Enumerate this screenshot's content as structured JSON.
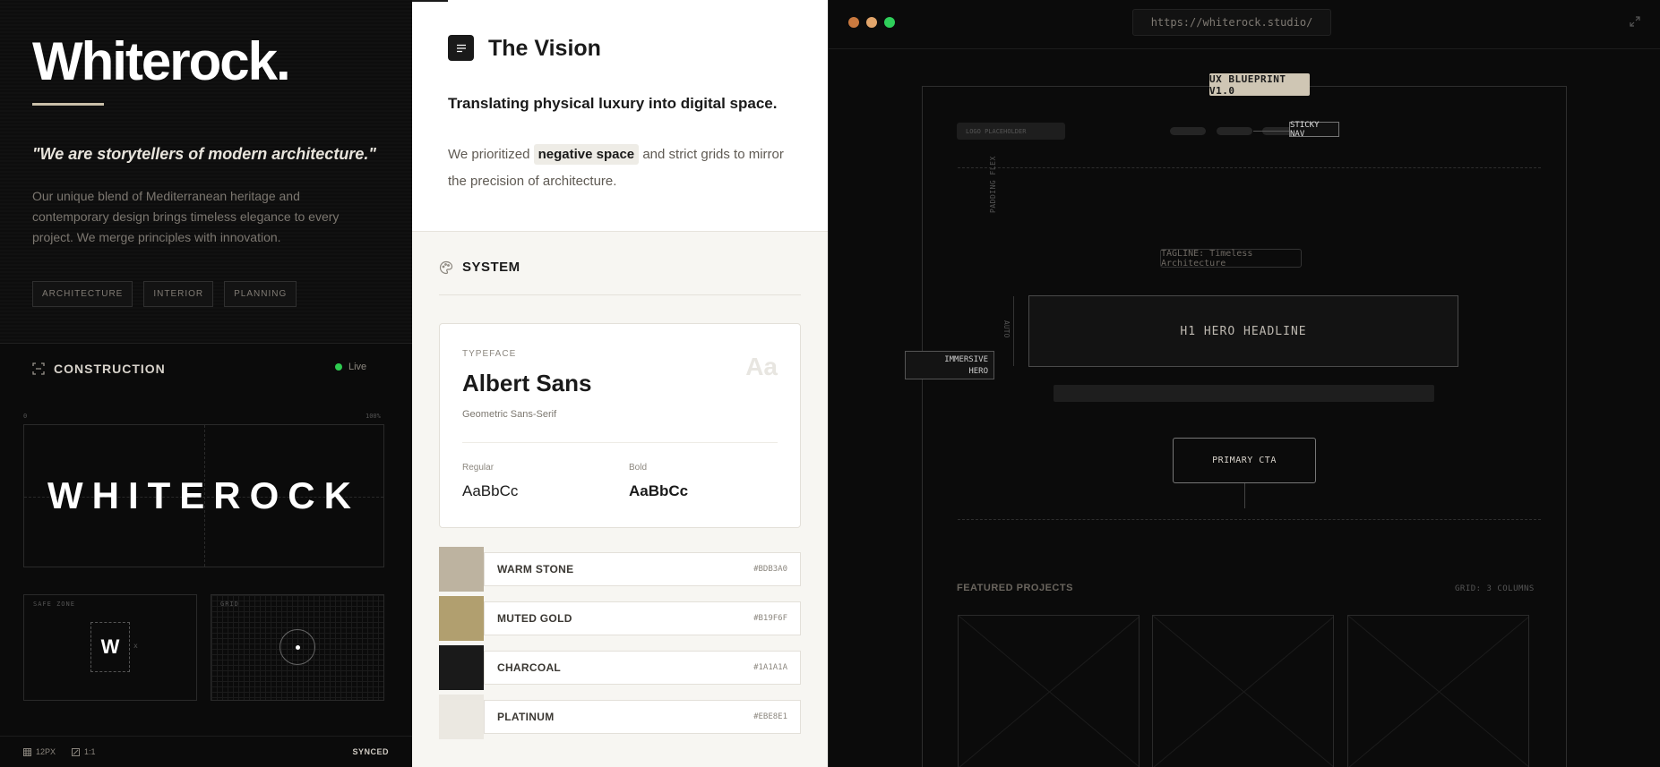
{
  "brand": {
    "title": "Whiterock.",
    "quote": "\"We are storytellers of modern architecture.\"",
    "description": "Our unique blend of Mediterranean heritage and contemporary design brings timeless elegance to every project. We merge principles with innovation.",
    "tags": [
      "ARCHITECTURE",
      "INTERIOR",
      "PLANNING"
    ]
  },
  "construction": {
    "title": "CONSTRUCTION",
    "status": "Live",
    "ruler_start": "0",
    "ruler_end": "100%",
    "wordmark": "WHITEROCK",
    "safe_zone_label": "SAFE ZONE",
    "safe_zone_letter": "W",
    "safe_zone_marker": "x",
    "grid_label": "GRID",
    "footer": {
      "grid_size": "12PX",
      "ratio": "1:1",
      "sync": "SYNCED"
    }
  },
  "vision": {
    "title": "The Vision",
    "subtitle": "Translating physical luxury into digital space.",
    "body_pre": "We prioritized",
    "body_highlight": "negative space",
    "body_post": "and strict grids to mirror the precision of architecture."
  },
  "system": {
    "title": "SYSTEM",
    "typeface": {
      "label": "TYPEFACE",
      "name": "Albert Sans",
      "style": "Geometric Sans-Serif",
      "sample": "Aa",
      "regular_label": "Regular",
      "regular_sample": "AaBbCc",
      "bold_label": "Bold",
      "bold_sample": "AaBbCc"
    },
    "swatches": [
      {
        "name": "WARM STONE",
        "hex": "#BDB3A0",
        "color": "#BDB3A0"
      },
      {
        "name": "MUTED GOLD",
        "hex": "#B19F6F",
        "color": "#B19F6F"
      },
      {
        "name": "CHARCOAL",
        "hex": "#1A1A1A",
        "color": "#1A1A1A"
      },
      {
        "name": "PLATINUM",
        "hex": "#EBE8E1",
        "color": "#EBE8E1"
      }
    ]
  },
  "preview": {
    "url": "https://whiterock.studio/",
    "badge": "UX BLUEPRINT V1.0",
    "logo_placeholder": "LOGO PLACEHOLDER",
    "sticky_nav": "STICKY NAV",
    "padding_label": "PADDING FLEX",
    "tagline": "TAGLINE: Timeless Architecture",
    "auto_label": "AUTO",
    "hero": "H1 HERO HEADLINE",
    "immersive_line1": "IMMERSIVE",
    "immersive_line2": "HERO",
    "cta": "PRIMARY CTA",
    "featured": "FEATURED PROJECTS",
    "grid_cols": "GRID: 3 COLUMNS"
  }
}
